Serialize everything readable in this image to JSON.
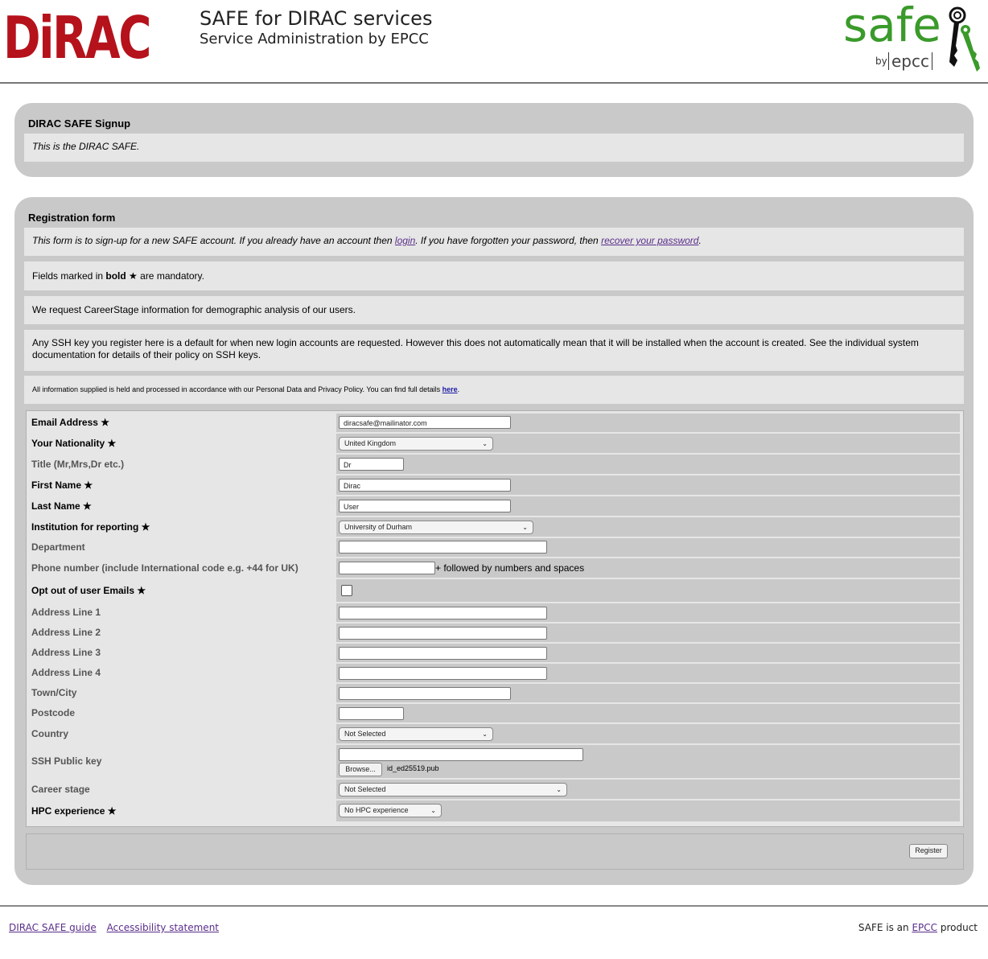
{
  "header": {
    "logo_text": "DiRAC",
    "title": "SAFE for DIRAC services",
    "subtitle": "Service Administration by EPCC",
    "safe_logo_word": "safe",
    "safe_logo_by": "by",
    "safe_logo_epcc": "epcc"
  },
  "signup_panel": {
    "heading": "DIRAC SAFE Signup",
    "intro": "This is the DIRAC SAFE."
  },
  "registration": {
    "heading": "Registration form",
    "note1_pre": "This form is to sign-up for a new SAFE account. If you already have an account then ",
    "note1_login": "login",
    "note1_mid": ". If you have forgotten your password, then ",
    "note1_recover": "recover your password",
    "note1_end": ".",
    "note2_pre": "Fields marked in ",
    "note2_bold": "bold",
    "note2_star": " ★ ",
    "note2_post": "are mandatory.",
    "note3": "We request CareerStage information for demographic analysis of our users.",
    "note4": "Any SSH key you register here is a default for when new login accounts are requested. However this does not automatically mean that it will be installed when the account is created. See the individual system documentation for details of their policy on SSH keys.",
    "note5_pre": "All information supplied is held and processed in accordance with our Personal Data and Privacy Policy. You can find full details ",
    "note5_link": "here",
    "note5_end": "."
  },
  "form": {
    "email_label": "Email Address ★",
    "email_value": "diracsafe@mailinator.com",
    "nationality_label": "Your Nationality ★",
    "nationality_value": "United Kingdom",
    "title_label": "Title (Mr,Mrs,Dr etc.)",
    "title_value": "Dr",
    "first_label": "First Name ★",
    "first_value": "Dirac",
    "last_label": "Last Name ★",
    "last_value": "User",
    "institution_label": "Institution for reporting ★",
    "institution_value": "University of Durham",
    "department_label": "Department",
    "department_value": "",
    "phone_label": "Phone number (include International code e.g. +44 for UK)",
    "phone_value": "",
    "phone_hint": "+ followed by numbers and spaces",
    "optout_label": "Opt out of user Emails ★",
    "optout_checked": false,
    "addr1_label": "Address Line 1",
    "addr2_label": "Address Line 2",
    "addr3_label": "Address Line 3",
    "addr4_label": "Address Line 4",
    "town_label": "Town/City",
    "postcode_label": "Postcode",
    "country_label": "Country",
    "country_value": "Not Selected",
    "ssh_label": "SSH Public key",
    "ssh_value": "",
    "browse_label": "Browse...",
    "ssh_file": "id_ed25519.pub",
    "career_label": "Career stage",
    "career_value": "Not Selected",
    "hpc_label": "HPC experience ★",
    "hpc_value": "No HPC experience",
    "register_label": "Register"
  },
  "footer": {
    "guide_link": "DIRAC SAFE guide",
    "accessibility_link": "Accessibility statement",
    "product_pre": "SAFE is an ",
    "product_link": "EPCC",
    "product_post": " product"
  },
  "colors": {
    "dirac_red": "#b5121b",
    "safe_green": "#3a9a2a",
    "panel_gray": "#c9c9c9",
    "row_gray": "#e6e6e6",
    "link_purple": "#5a2e8a"
  }
}
